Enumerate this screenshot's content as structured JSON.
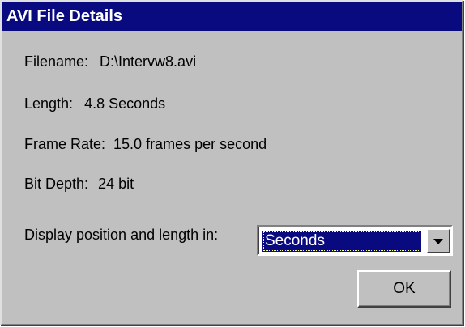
{
  "window": {
    "title": "AVI File Details"
  },
  "details": {
    "filename_label": "Filename:",
    "filename_value": "D:\\Intervw8.avi",
    "length_label": "Length:",
    "length_value": "4.8 Seconds",
    "frame_rate_label": "Frame Rate:",
    "frame_rate_value": "15.0 frames per second",
    "bit_depth_label": "Bit Depth:",
    "bit_depth_value": "24 bit"
  },
  "display": {
    "label": "Display position and length in:",
    "selected": "Seconds"
  },
  "buttons": {
    "ok_label": "OK"
  },
  "colors": {
    "title_bar": "#0a0a80",
    "dialog_face": "#c0c0c0",
    "selection": "#0a0a80"
  },
  "icons": {
    "dropdown": "chevron-down-icon"
  }
}
